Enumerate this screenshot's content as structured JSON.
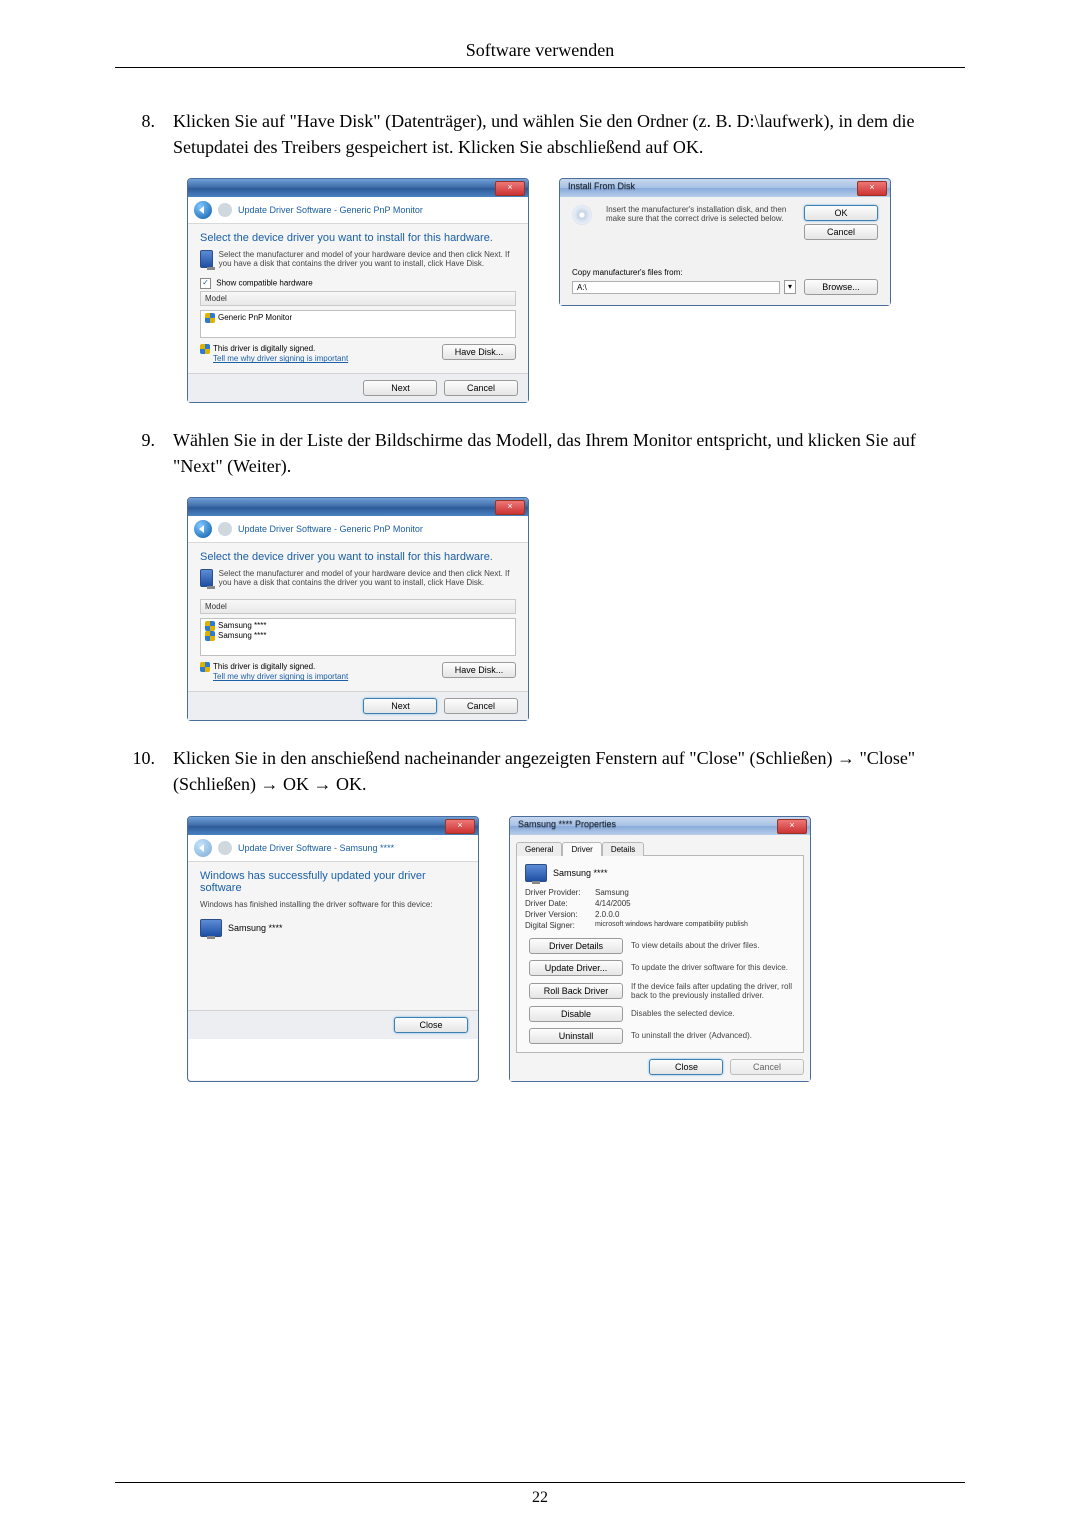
{
  "header": {
    "title": "Software verwenden"
  },
  "steps": {
    "s8": {
      "num": "8.",
      "text": "Klicken Sie auf \"Have Disk\" (Datenträger), und wählen Sie den Ordner (z. B. D:\\laufwerk), in dem die Setupdatei des Treibers gespeichert ist. Klicken Sie abschließend auf OK."
    },
    "s9": {
      "num": "9.",
      "text": "Wählen Sie in der Liste der Bildschirme das Modell, das Ihrem Monitor entspricht, und klicken Sie auf \"Next\" (Weiter)."
    },
    "s10": {
      "num": "10.",
      "text": "Klicken Sie in den anschießend nacheinander angezeigten Fenstern auf \"Close\" (Schließen) → \"Close\" (Schließen) → OK → OK."
    }
  },
  "dlg_select1": {
    "crumb": "Update Driver Software - Generic PnP Monitor",
    "heading": "Select the device driver you want to install for this hardware.",
    "sub": "Select the manufacturer and model of your hardware device and then click Next. If you have a disk that contains the driver you want to install, click Have Disk.",
    "showcompat": "Show compatible hardware",
    "col_model": "Model",
    "row1": "Generic PnP Monitor",
    "signed": "This driver is digitally signed.",
    "tell": "Tell me why driver signing is important",
    "havedisk": "Have Disk...",
    "next": "Next",
    "cancel": "Cancel"
  },
  "dlg_install": {
    "title": "Install From Disk",
    "msg": "Insert the manufacturer's installation disk, and then make sure that the correct drive is selected below.",
    "ok": "OK",
    "cancel": "Cancel",
    "copy": "Copy manufacturer's files from:",
    "path": "A:\\",
    "browse": "Browse..."
  },
  "dlg_select2": {
    "crumb": "Update Driver Software - Generic PnP Monitor",
    "heading": "Select the device driver you want to install for this hardware.",
    "sub": "Select the manufacturer and model of your hardware device and then click Next. If you have a disk that contains the driver you want to install, click Have Disk.",
    "col_model": "Model",
    "row1": "Samsung ****",
    "row2": "Samsung ****",
    "signed": "This driver is digitally signed.",
    "tell": "Tell me why driver signing is important",
    "havedisk": "Have Disk...",
    "next": "Next",
    "cancel": "Cancel"
  },
  "dlg_done": {
    "crumb": "Update Driver Software - Samsung ****",
    "heading": "Windows has successfully updated your driver software",
    "sub": "Windows has finished installing the driver software for this device:",
    "device": "Samsung ****",
    "close": "Close"
  },
  "dlg_props": {
    "title": "Samsung **** Properties",
    "tab_general": "General",
    "tab_driver": "Driver",
    "tab_details": "Details",
    "device": "Samsung ****",
    "provider_k": "Driver Provider:",
    "provider_v": "Samsung",
    "date_k": "Driver Date:",
    "date_v": "4/14/2005",
    "ver_k": "Driver Version:",
    "ver_v": "2.0.0.0",
    "signer_k": "Digital Signer:",
    "signer_v": "microsoft windows hardware compatibility publish",
    "btn_details": "Driver Details",
    "btn_details_d": "To view details about the driver files.",
    "btn_update": "Update Driver...",
    "btn_update_d": "To update the driver software for this device.",
    "btn_roll": "Roll Back Driver",
    "btn_roll_d": "If the device fails after updating the driver, roll back to the previously installed driver.",
    "btn_disable": "Disable",
    "btn_disable_d": "Disables the selected device.",
    "btn_uninst": "Uninstall",
    "btn_uninst_d": "To uninstall the driver (Advanced).",
    "close": "Close",
    "cancel": "Cancel"
  },
  "page_number": "22"
}
